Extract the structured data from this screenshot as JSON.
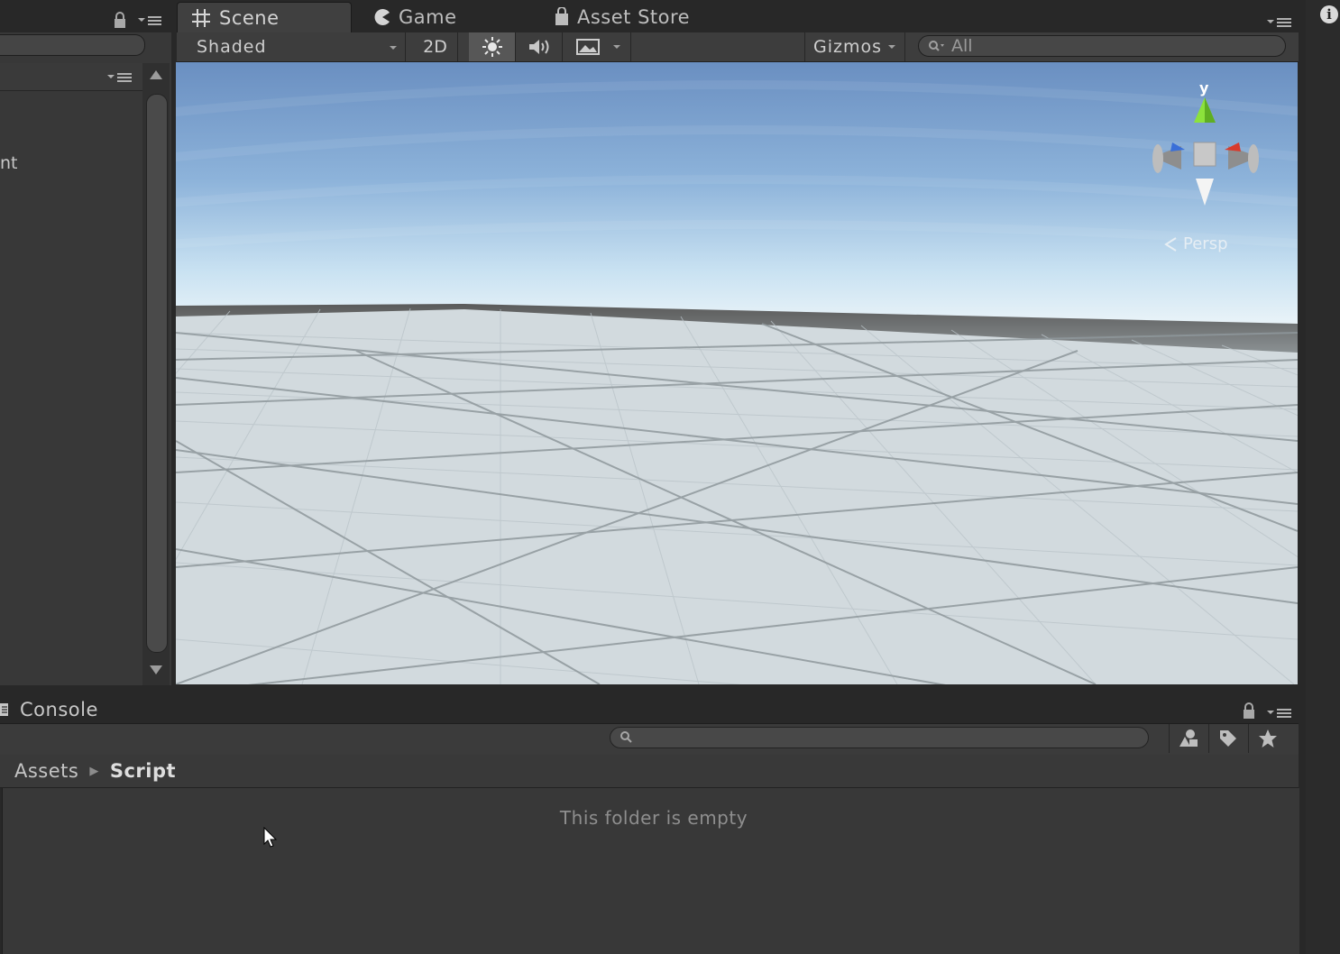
{
  "hierarchy": {
    "item_fragment": "nt"
  },
  "tabs": {
    "scene": "Scene",
    "game": "Game",
    "asset_store": "Asset Store"
  },
  "scene_toolbar": {
    "shading_mode": "Shaded",
    "mode_2d": "2D",
    "gizmos": "Gizmos",
    "search_value": "All"
  },
  "scene_gizmo": {
    "y_label": "y",
    "projection": "Persp"
  },
  "bottom_panel": {
    "console_tab": "Console",
    "breadcrumb": {
      "root": "Assets",
      "current": "Script"
    },
    "empty_message": "This folder is empty"
  },
  "colors": {
    "editor_bg": "#383838",
    "sky_top": "#6d92c4",
    "sky_horizon": "#e6f2fa",
    "ground": "#d3dbdf",
    "axis_x": "#d83a2c",
    "axis_y": "#8ce23c",
    "axis_z": "#3a6fd8"
  },
  "icons": [
    "lock-icon",
    "menu-icon",
    "scene-grid-icon",
    "game-pacman-icon",
    "asset-store-bag-icon",
    "sun-icon",
    "audio-icon",
    "image-effects-icon",
    "search-icon",
    "info-icon",
    "console-icon",
    "filter-by-type-icon",
    "tag-icon",
    "star-icon",
    "cursor-icon"
  ]
}
